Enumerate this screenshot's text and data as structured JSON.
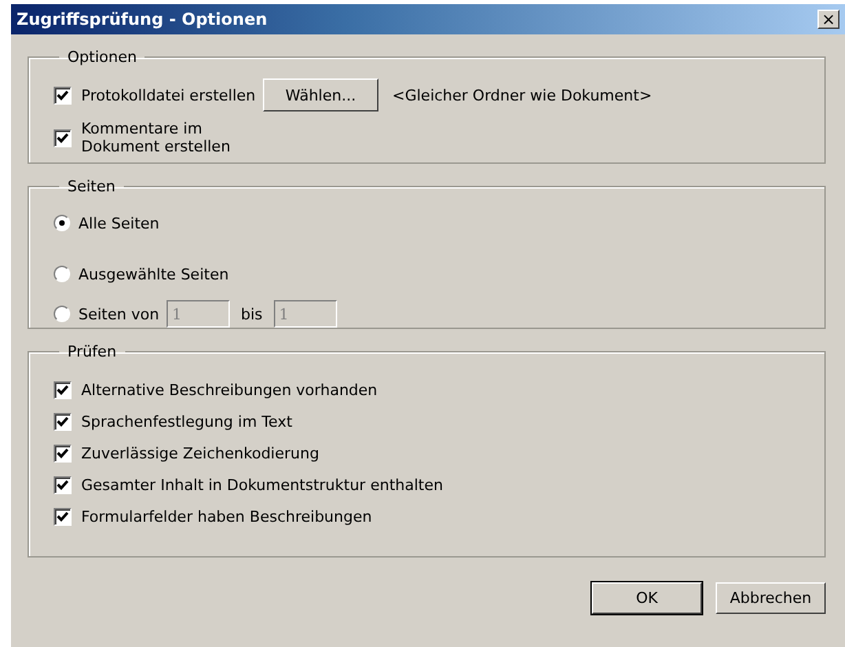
{
  "window": {
    "title": "Zugriffsprüfung - Optionen",
    "close": "×"
  },
  "options": {
    "legend": "Optionen",
    "items": [
      {
        "label": "Protokolldatei erstellen",
        "checked": true,
        "button": "Wählen...",
        "path": "<Gleicher Ordner wie Dokument>"
      },
      {
        "label": "Kommentare im Dokument erstellen",
        "checked": true
      }
    ]
  },
  "pages": {
    "legend": "Seiten",
    "radios": [
      {
        "label": "Alle Seiten",
        "selected": true
      },
      {
        "label": "Ausgewählte Seiten",
        "selected": false
      },
      {
        "label": "Seiten von",
        "selected": false
      }
    ],
    "from": {
      "value": "1",
      "disabled": true
    },
    "to_label": "bis",
    "to": {
      "value": "1",
      "disabled": true
    }
  },
  "checks": {
    "legend": "Prüfen",
    "items": [
      {
        "label": "Alternative Beschreibungen vorhanden",
        "checked": true
      },
      {
        "label": "Sprachenfestlegung im Text",
        "checked": true
      },
      {
        "label": "Zuverlässige Zeichenkodierung",
        "checked": true
      },
      {
        "label": "Gesamter Inhalt in Dokumentstruktur enthalten",
        "checked": true
      },
      {
        "label": "Formularfelder haben Beschreibungen",
        "checked": true
      }
    ]
  },
  "buttons": [
    {
      "label": "OK",
      "default": true
    },
    {
      "label": "Abbrechen",
      "default": false
    }
  ]
}
